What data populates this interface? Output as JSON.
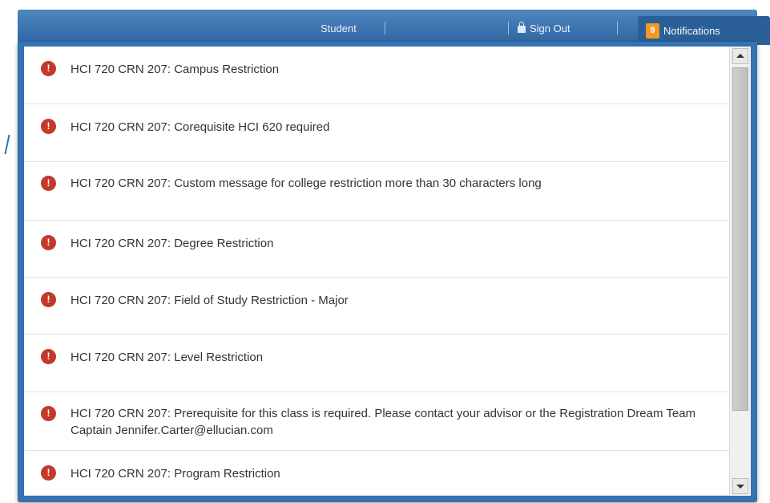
{
  "header": {
    "user_label": "Student",
    "sign_out_label": "Sign Out",
    "notifications_label": "Notifications",
    "notifications_count": "9"
  },
  "notifications": [
    {
      "icon": "error-icon",
      "message": "HCI 720 CRN 207: Campus Restriction"
    },
    {
      "icon": "error-icon",
      "message": "HCI 720 CRN 207: Corequisite HCI 620 required"
    },
    {
      "icon": "error-icon",
      "message": "HCI 720 CRN 207: Custom message for college restriction more than 30 characters long"
    },
    {
      "icon": "error-icon",
      "message": "HCI 720 CRN 207: Degree Restriction"
    },
    {
      "icon": "error-icon",
      "message": "HCI 720 CRN 207: Field of Study Restriction - Major"
    },
    {
      "icon": "error-icon",
      "message": "HCI 720 CRN 207: Level Restriction"
    },
    {
      "icon": "error-icon",
      "message": "HCI 720 CRN 207: Prerequisite for this class is required. Please contact your advisor or the Registration Dream Team Captain Jennifer.Carter@ellucian.com"
    },
    {
      "icon": "error-icon",
      "message": "HCI 720 CRN 207: Program Restriction"
    }
  ],
  "colors": {
    "header_blue": "#3472b1",
    "error_red": "#c33a2c",
    "badge_orange": "#f19a2b"
  }
}
